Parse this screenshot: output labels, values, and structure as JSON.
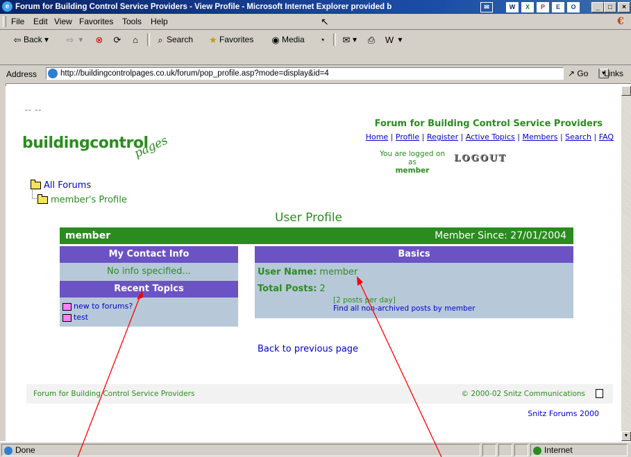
{
  "window": {
    "title": "Forum for Building Control Service Providers - View Profile - Microsoft Internet Explorer provided b",
    "controls": {
      "minimize": "_",
      "maximize": "□",
      "close": "×"
    }
  },
  "menu": [
    "File",
    "Edit",
    "View",
    "Favorites",
    "Tools",
    "Help"
  ],
  "toolbar": {
    "back": "Back",
    "search": "Search",
    "favorites": "Favorites",
    "media": "Media"
  },
  "address": {
    "label": "Address",
    "url": "http://buildingcontrolpages.co.uk/forum/pop_profile.asp?mode=display&id=4",
    "go": "Go",
    "links": "Links"
  },
  "page": {
    "dash": "-- --",
    "logo_main": "buildingcontrol",
    "logo_sub": "pages",
    "forum_title": "Forum for Building Control Service Providers",
    "nav": [
      "Home",
      "Profile",
      "Register",
      "Active Topics",
      "Members",
      "Search",
      "FAQ"
    ],
    "logged_text": "You are logged on as",
    "logged_user": "member",
    "logout": "LOGOUT",
    "crumb_all": "All Forums",
    "crumb_profile": "member's Profile",
    "profile_title": "User Profile",
    "member_name": "member",
    "member_since": "Member Since: 27/01/2004",
    "contact_head": "My Contact Info",
    "contact_value": "No info specified...",
    "recent_head": "Recent Topics",
    "topics": [
      "new to forums?",
      "test"
    ],
    "basics_head": "Basics",
    "username_label": "User Name:",
    "username_value": "member",
    "posts_label": "Total Posts:",
    "posts_value": "2",
    "posts_per_day": "[2 posts per day]",
    "find_posts": "Find all non-archived posts by member",
    "back": "Back to previous page",
    "footer_left": "Forum for Building Control Service Providers",
    "footer_right": "© 2000-02 Snitz Communications",
    "snitz": "Snitz Forums 2000"
  },
  "status": {
    "text": "Done",
    "zone": "Internet"
  },
  "colors": {
    "green": "#2a8c1e",
    "purple": "#6b53c3",
    "panel": "#b7c9d9",
    "annotation": "#ff0000"
  }
}
